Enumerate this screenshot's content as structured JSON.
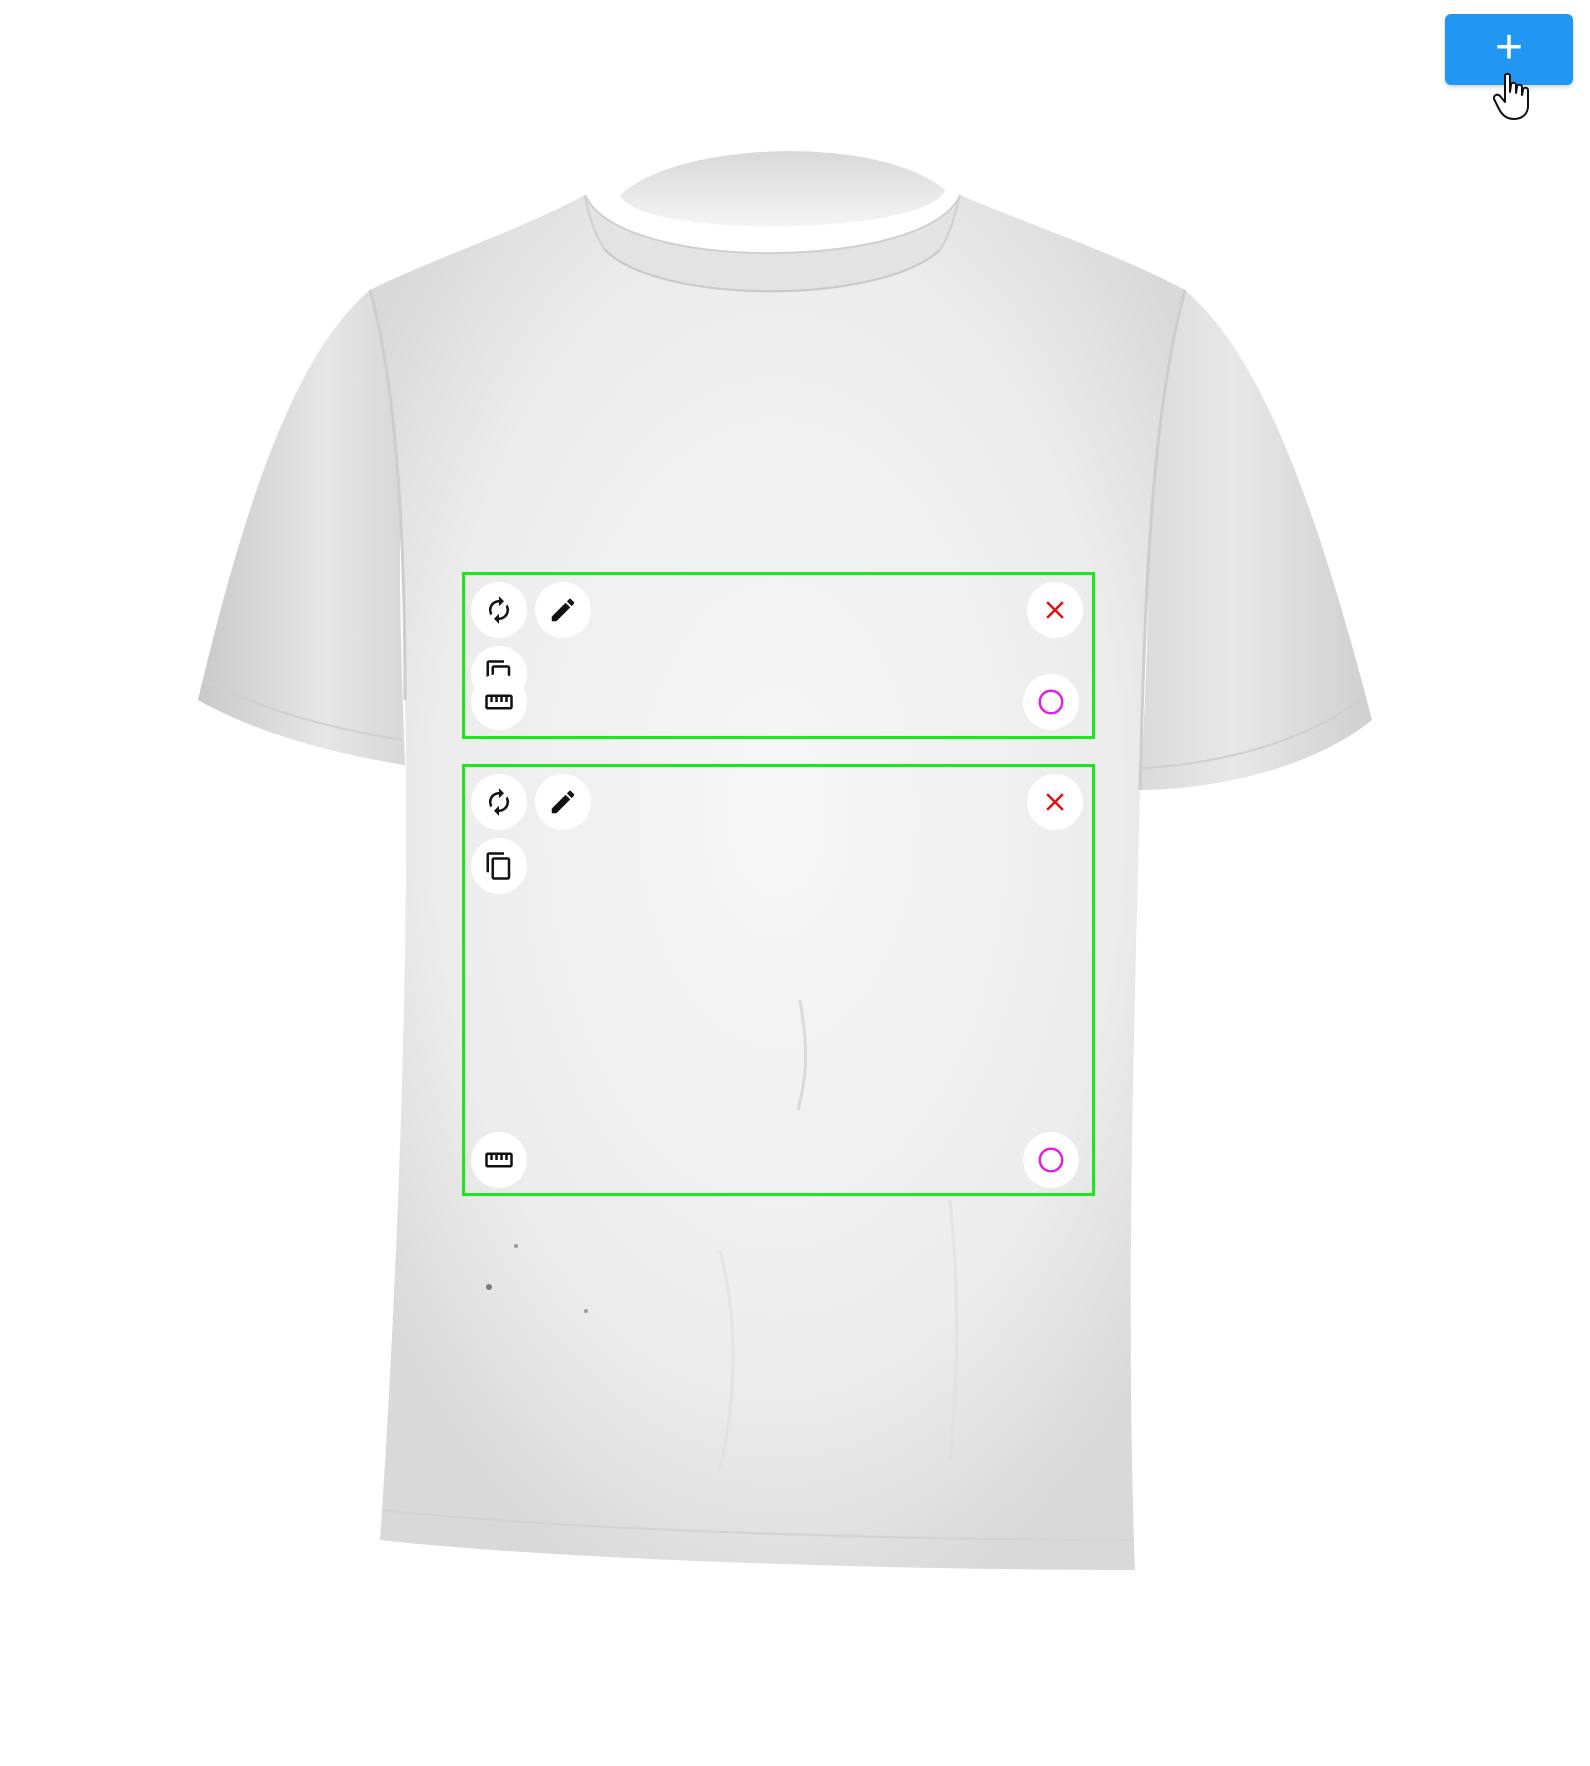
{
  "toolbar": {
    "add_button_label": "+",
    "add_button_icon": "plus-icon",
    "accent_color": "#2196f3"
  },
  "canvas": {
    "product": "white t-shirt",
    "print_area_border_color": "#1ee61e"
  },
  "print_areas": [
    {
      "controls_left_top": [
        "rotate-icon",
        "edit-pencil-icon",
        "copy-icon"
      ],
      "controls_left_bottom": [
        "ruler-icon"
      ],
      "controls_right_top": [
        "close-icon"
      ],
      "controls_right_bottom": [
        "circle-icon"
      ]
    },
    {
      "controls_left_top": [
        "rotate-icon",
        "edit-pencil-icon",
        "copy-icon"
      ],
      "controls_left_bottom": [
        "ruler-icon"
      ],
      "controls_right_top": [
        "close-icon"
      ],
      "controls_right_bottom": [
        "circle-icon"
      ]
    }
  ],
  "colors": {
    "close_icon": "#e81010",
    "circle_icon": "#e020e0",
    "icon_dark": "#111111"
  }
}
